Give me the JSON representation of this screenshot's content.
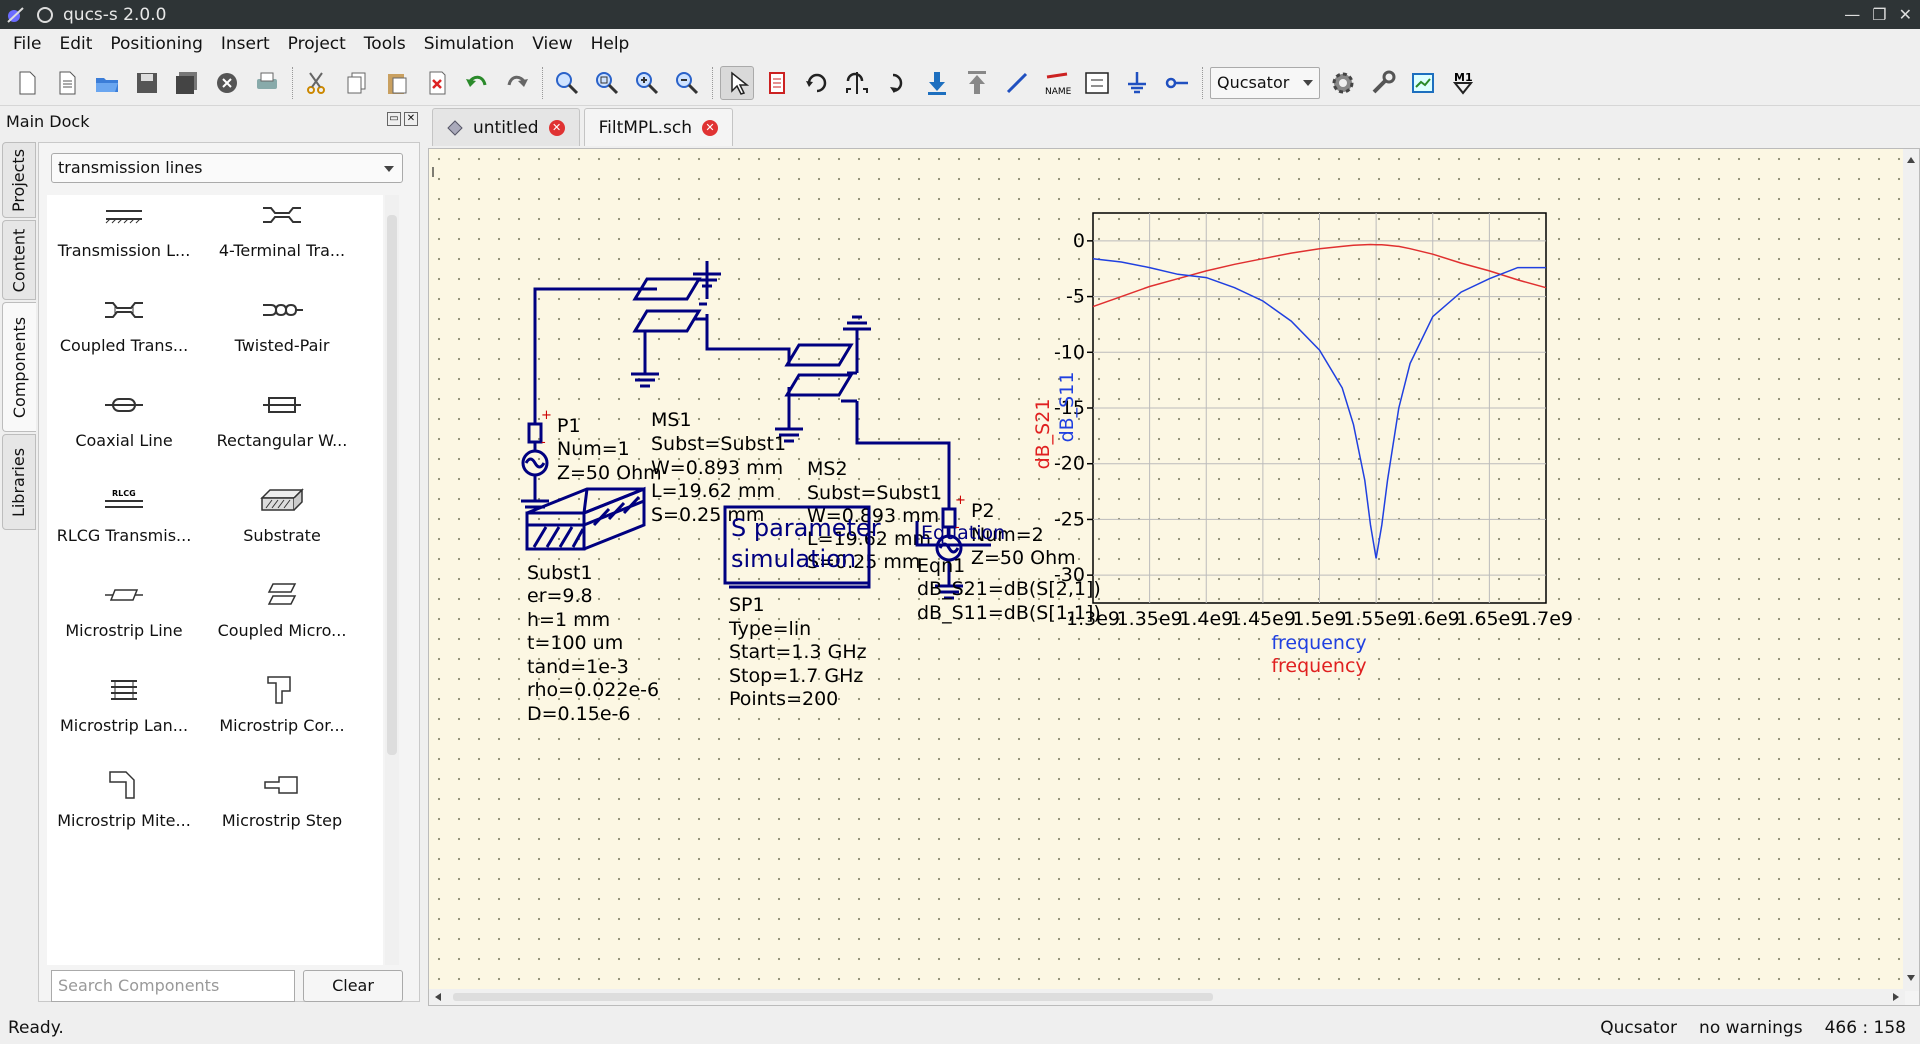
{
  "window": {
    "title": "qucs-s 2.0.0"
  },
  "menu": [
    "File",
    "Edit",
    "Positioning",
    "Insert",
    "Project",
    "Tools",
    "Simulation",
    "View",
    "Help"
  ],
  "toolbar": {
    "simulator_select": "Qucsator",
    "icons": [
      "new-file-icon",
      "new-text-icon",
      "open-icon",
      "save-icon",
      "save-all-icon",
      "close-icon",
      "print-icon",
      "cut-icon",
      "copy-icon",
      "paste-icon",
      "delete-icon",
      "undo-icon",
      "redo-icon",
      "zoom-fit-icon",
      "zoom-select-icon",
      "zoom-in-icon",
      "zoom-out-icon",
      "select-icon",
      "deactivate-icon",
      "rotate-icon",
      "mirror-icon",
      "go-into-icon",
      "push-down-icon",
      "pop-up-icon",
      "wire-icon",
      "label-icon",
      "equation-icon",
      "ground-icon",
      "port-icon",
      "simulate-icon",
      "settings-icon",
      "view-dpl-icon",
      "marker-icon"
    ]
  },
  "dock": {
    "title": "Main Dock",
    "tabs": [
      "Projects",
      "Content",
      "Components",
      "Libraries"
    ],
    "active_tab": "Components",
    "category": "transmission lines",
    "components": [
      "Transmission L...",
      "4-Terminal Tra...",
      "Coupled Trans...",
      "Twisted-Pair",
      "Coaxial Line",
      "Rectangular W...",
      "RLCG Transmis...",
      "Substrate",
      "Microstrip Line",
      "Coupled Micro...",
      "Microstrip Lan...",
      "Microstrip Cor...",
      "Microstrip Mite...",
      "Microstrip Step"
    ],
    "rlcg_icon_text": "RLCG",
    "search_placeholder": "Search Components",
    "clear_label": "Clear"
  },
  "doc_tabs": [
    {
      "label": "untitled",
      "active": false
    },
    {
      "label": "FiltMPL.sch",
      "active": true
    }
  ],
  "schematic": {
    "p1": {
      "name": "P1",
      "props": [
        "Num=1",
        "Z=50 Ohm"
      ]
    },
    "ms1": {
      "name": "MS1",
      "props": [
        "Subst=Subst1",
        "W=0.893 mm",
        "L=19.62 mm",
        "S=0.25 mm"
      ]
    },
    "ms2": {
      "name": "MS2",
      "props": [
        "Subst=Subst1",
        "W=0.893 mm",
        "L=19.62 mm",
        "S=0.25 mm"
      ]
    },
    "p2": {
      "name": "P2",
      "props": [
        "Num=2",
        "Z=50 Ohm"
      ]
    },
    "subst": {
      "name": "Subst1",
      "props": [
        "er=9.8",
        "h=1 mm",
        "t=100 um",
        "tand=1e-3",
        "rho=0.022e-6",
        "D=0.15e-6"
      ]
    },
    "sim": {
      "box_lines": [
        "S parameter",
        "simulation"
      ],
      "name": "SP1",
      "props": [
        "Type=lin",
        "Start=1.3 GHz",
        "Stop=1.7 GHz",
        "Points=200"
      ]
    },
    "eqn": {
      "box": "Equation",
      "name": "Eqn1",
      "props": [
        "dB_S21=dB(S[2,1])",
        "dB_S11=dB(S[1,1])"
      ]
    }
  },
  "chart_data": {
    "type": "line",
    "xlabel": [
      "frequency",
      "frequency"
    ],
    "ylabel": [
      "dB_S21",
      "dB_S11"
    ],
    "xlim": [
      1300000000.0,
      1700000000.0
    ],
    "ylim": [
      -32.5,
      2.5
    ],
    "xticks": [
      "1.3e9",
      "1.35e9",
      "1.4e9",
      "1.45e9",
      "1.5e9",
      "1.55e9",
      "1.6e9",
      "1.65e9",
      "1.7e9"
    ],
    "yticks": [
      "0",
      "-5",
      "-10",
      "-15",
      "-20",
      "-25",
      "-30"
    ],
    "ytick_values": [
      0,
      -5,
      -10,
      -15,
      -20,
      -25,
      -30
    ],
    "grid": true,
    "x": [
      1300000000.0,
      1325000000.0,
      1350000000.0,
      1375000000.0,
      1400000000.0,
      1425000000.0,
      1450000000.0,
      1475000000.0,
      1500000000.0,
      1520000000.0,
      1530000000.0,
      1540000000.0,
      1545000000.0,
      1550000000.0,
      1555000000.0,
      1560000000.0,
      1570000000.0,
      1580000000.0,
      1600000000.0,
      1625000000.0,
      1650000000.0,
      1675000000.0,
      1700000000.0
    ],
    "series": [
      {
        "name": "dB_S21",
        "color": "#e03030",
        "values": [
          -5.9,
          -5.0,
          -4.1,
          -3.4,
          -2.7,
          -2.1,
          -1.6,
          -1.1,
          -0.7,
          -0.5,
          -0.4,
          -0.35,
          -0.33,
          -0.35,
          -0.35,
          -0.4,
          -0.5,
          -0.7,
          -1.2,
          -2.0,
          -2.7,
          -3.5,
          -4.2
        ]
      },
      {
        "name": "dB_S11",
        "color": "#2040e0",
        "values": [
          -1.6,
          -1.9,
          -2.4,
          -3.0,
          -3.3,
          -4.2,
          -5.4,
          -7.2,
          -9.8,
          -13.2,
          -16.5,
          -21.5,
          -25.5,
          -28.5,
          -25.5,
          -21.5,
          -15.0,
          -11.0,
          -6.8,
          -4.6,
          -3.4,
          -2.4,
          -2.4
        ]
      }
    ]
  },
  "status": {
    "left": "Ready.",
    "simulator": "Qucsator",
    "warnings": "no warnings",
    "coords": "466 : 158"
  }
}
